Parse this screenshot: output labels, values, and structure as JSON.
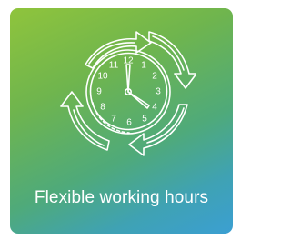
{
  "card": {
    "caption": "Flexible working hours",
    "icon": "clock-with-cycle-arrows-icon",
    "colors": {
      "gradient_start": "#8fc43c",
      "gradient_end": "#3b9fd2",
      "foreground": "#ffffff"
    }
  },
  "clock": {
    "numerals": [
      "12",
      "1",
      "2",
      "3",
      "4",
      "5",
      "6",
      "7",
      "8",
      "9",
      "10",
      "11"
    ]
  }
}
